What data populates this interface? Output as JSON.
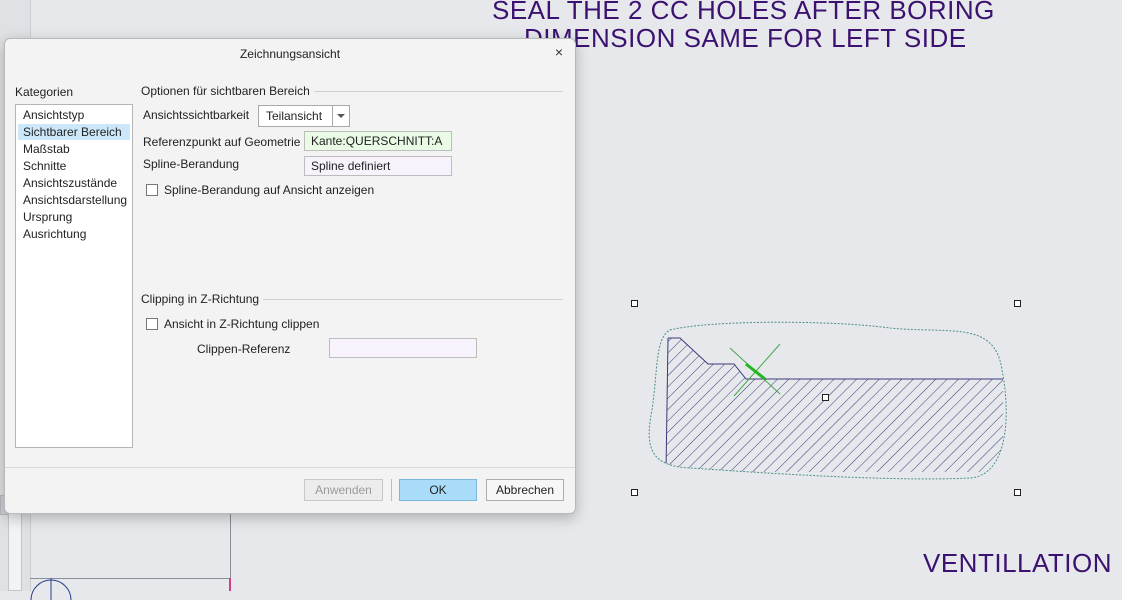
{
  "canvas": {
    "notes": [
      "SEAL THE 2 CC HOLES AFTER BORING",
      "DIMENSION SAME FOR LEFT SIDE",
      "VENTILLATION"
    ],
    "note_color": "#3b1270",
    "hatch_color": "#3a3a7a",
    "spline_color": "#4d8f86",
    "reference_marker_color": "#1fb81f"
  },
  "dialog": {
    "title": "Zeichnungsansicht",
    "close_glyph": "×",
    "categories_label": "Kategorien",
    "categories": [
      "Ansichtstyp",
      "Sichtbarer Bereich",
      "Maßstab",
      "Schnitte",
      "Ansichtszustände",
      "Ansichtsdarstellung",
      "Ursprung",
      "Ausrichtung"
    ],
    "selected_category": "Sichtbarer Bereich",
    "visible_area": {
      "group_title": "Optionen für sichtbaren Bereich",
      "visibility_label": "Ansichtssichtbarkeit",
      "visibility_value": "Teilansicht",
      "reference_label": "Referenzpunkt auf Geometrie",
      "reference_value": "Kante:QUERSCHNITT:A",
      "spline_label": "Spline-Berandung",
      "spline_value": "Spline definiert",
      "show_spline_label": "Spline-Berandung auf Ansicht anzeigen",
      "show_spline_checked": false
    },
    "clipping": {
      "group_title": "Clipping in Z-Richtung",
      "clip_label": "Ansicht in Z-Richtung clippen",
      "clip_checked": false,
      "clip_reference_label": "Clippen-Referenz",
      "clip_reference_value": ""
    },
    "buttons": {
      "apply": "Anwenden",
      "ok": "OK",
      "cancel": "Abbrechen"
    },
    "colors": {
      "selection": "#cce7fa",
      "ok_button": "#a9dcf9",
      "reference_field": "#e9fbe4",
      "spline_field": "#f8f2fc"
    }
  }
}
